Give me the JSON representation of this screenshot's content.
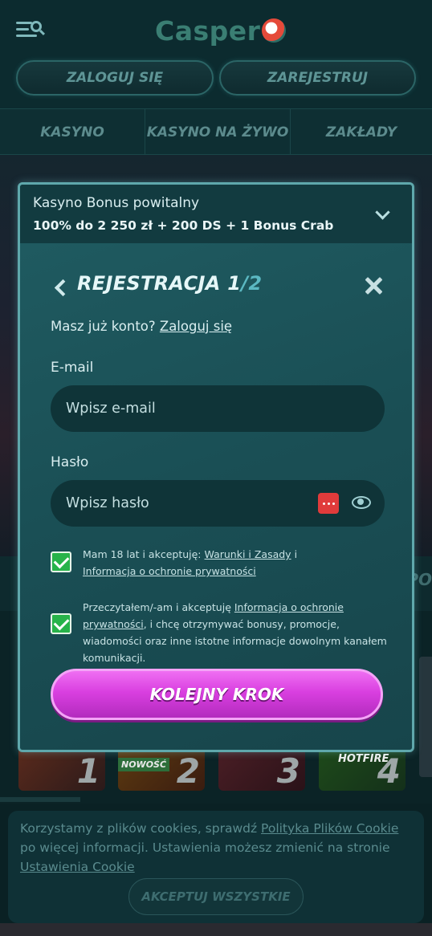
{
  "header": {
    "logo_text": "Casper",
    "login_label": "ZALOGUJ SIĘ",
    "register_label": "ZAREJESTRUJ"
  },
  "nav": {
    "tabs": [
      {
        "label": "KASYNO"
      },
      {
        "label": "KASYNO NA ŻYWO"
      },
      {
        "label": "ZAKŁADY"
      }
    ]
  },
  "background": {
    "strip_text": "PO",
    "games": [
      {
        "num": "1",
        "tag": ""
      },
      {
        "num": "2",
        "tag": "NOWOŚĆ"
      },
      {
        "num": "3",
        "tag": ""
      },
      {
        "num": "4",
        "tag": "HOTFIRE"
      }
    ]
  },
  "bonus": {
    "title": "Kasyno Bonus powitalny",
    "value": "100% do 2 250 zł + 200 DS + 1 Bonus Crab"
  },
  "registration": {
    "title": "REJESTRACJA",
    "step": "1",
    "total": "/2",
    "have_account": "Masz już konto?",
    "login_link": "Zaloguj się",
    "email_label": "E-mail",
    "email_placeholder": "Wpisz e-mail",
    "email_value": "",
    "password_label": "Hasło",
    "password_placeholder": "Wpisz hasło",
    "password_value": "",
    "consent1_prefix": "Mam 18 lat i akceptuję:",
    "consent1_link1": "Warunki i Zasady",
    "consent1_mid": "i",
    "consent1_link2": "Informacja o ochronie prywatności",
    "consent1_checked": true,
    "consent2_prefix": "Przeczytałem/-am i akceptuję",
    "consent2_link": "Informacja o ochronie prywatności",
    "consent2_suffix": ", i chcę otrzymywać bonusy, promocje, wiadomości oraz inne istotne informacje dowolnym kanałem komunikacji.",
    "consent2_checked": true,
    "next_label": "KOLEJNY KROK"
  },
  "cookie": {
    "text1": "Korzystamy z plików cookies, sprawdź",
    "link1": "Polityka Plików Cookie",
    "text2": "po więcej informacji. Ustawienia możesz zmienić na stronie",
    "link2": "Ustawienia Cookie",
    "accept_label": "AKCEPTUJ WSZYSTKIE"
  },
  "colors": {
    "accent": "#d93fe0",
    "check_green": "#27b34a",
    "modal_border": "#5fa8ac"
  }
}
